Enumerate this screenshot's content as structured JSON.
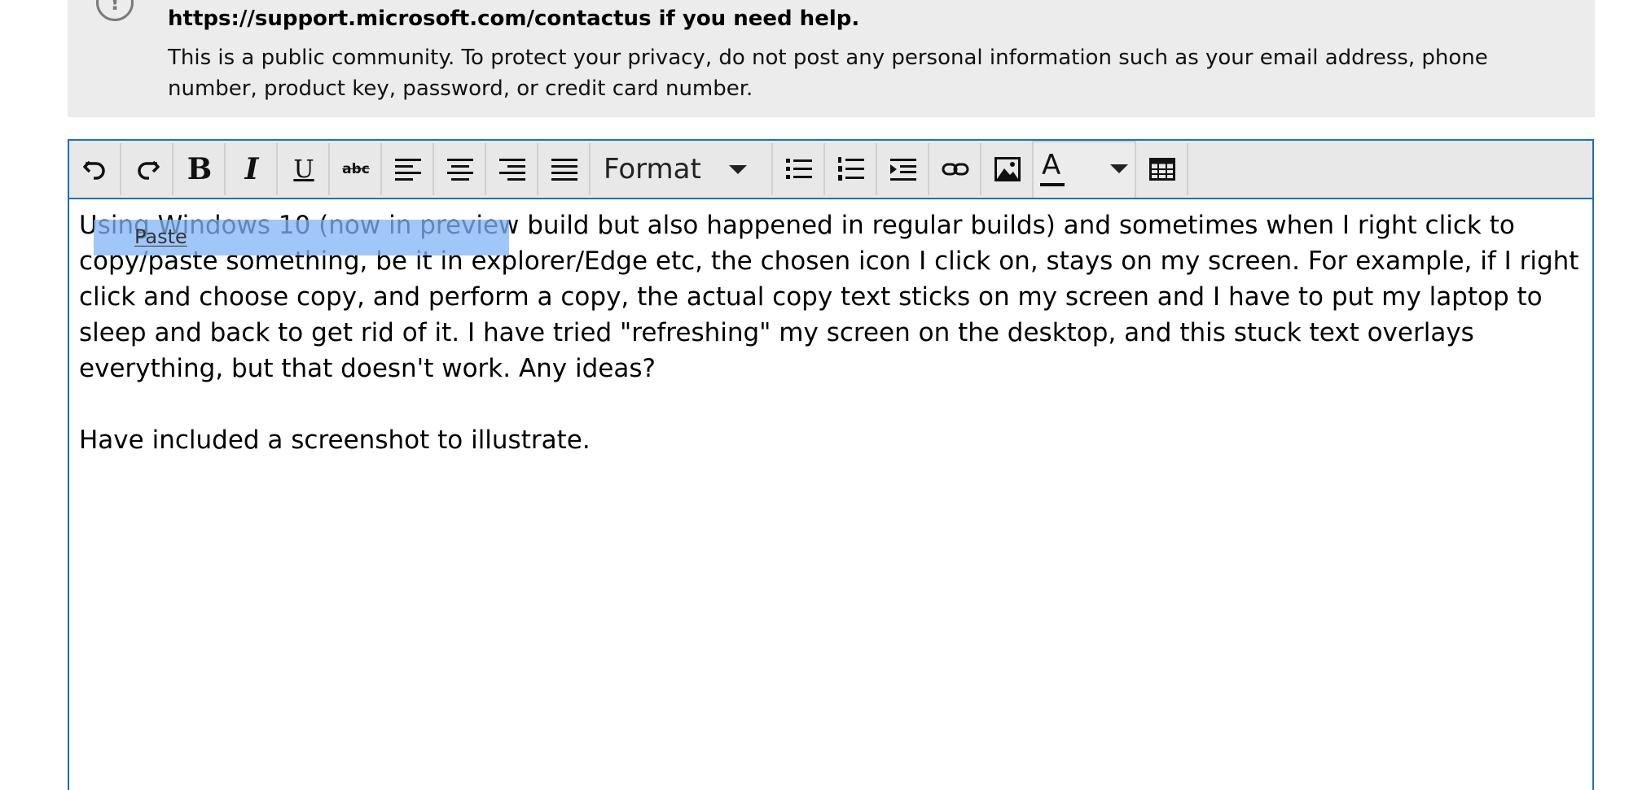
{
  "notice": {
    "link_line": "https://support.microsoft.com/contactus if you need help.",
    "privacy_text": "This is a public community. To protect your privacy, do not post any personal information such as your email address, phone number, product key, password, or credit card number."
  },
  "toolbar": {
    "buttons": [
      "undo-icon",
      "redo-icon",
      "bold-icon",
      "italic-icon",
      "underline-icon",
      "strikethrough-icon",
      "align-left-icon",
      "align-center-icon",
      "align-right-icon",
      "justify-icon",
      "bullet-list-icon",
      "numbered-list-icon",
      "indent-icon",
      "link-icon",
      "image-icon",
      "text-color-icon",
      "table-icon"
    ],
    "bold_label": "B",
    "italic_label": "I",
    "underline_label": "U",
    "strike_label": "abc",
    "format_label": "Format",
    "color_label": "A",
    "accent_color": "#1f6fb8"
  },
  "editor": {
    "paragraph1": "Using Windows 10 (now in preview build but also happened in regular builds) and sometimes when I right click to copy/paste something, be it in explorer/Edge etc, the chosen icon I click on, stays on my screen. For example, if I right click and choose copy, and perform a copy, the actual copy text sticks on my screen and I have to put my laptop to sleep and back to get rid of it. I have tried \"refreshing\" my screen on the desktop, and this stuck text overlays everything, but that doesn't work. Any ideas?",
    "paragraph2": "Have included a screenshot to illustrate."
  },
  "overlay": {
    "paste_label": "Paste"
  }
}
